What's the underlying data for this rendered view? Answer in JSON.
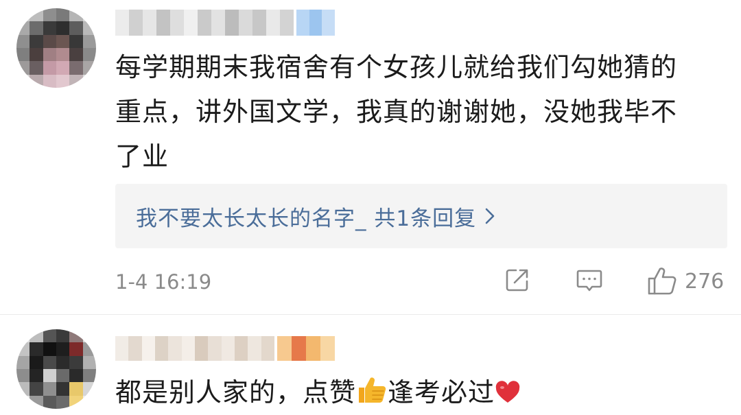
{
  "comments": [
    {
      "text_lines": [
        "每学期期末我宿舍有个女孩儿就给我们勾她猜的",
        "重点，讲外国文学，我真的谢谢她，没她我毕不",
        "了业"
      ],
      "reply_link": "我不要太长太长的名字_ 共1条回复",
      "timestamp": "1-4 16:19",
      "like_count": "276",
      "icons": [
        "share-icon",
        "comment-icon",
        "thumbs-up-icon",
        "chevron-right-icon"
      ]
    },
    {
      "text_part1": "都是别人家的，点赞",
      "text_part2": "逢考必过",
      "icons": [
        "thumbs-up-emoji",
        "heart-emoji"
      ]
    }
  ],
  "colors": {
    "text": "#1b1b1b",
    "reply_link": "#4a6d99",
    "meta": "#8a8a8a",
    "reply_bg": "#f4f4f4",
    "heart": "#e0313b",
    "thumbs_emoji": "#f5b62b"
  }
}
